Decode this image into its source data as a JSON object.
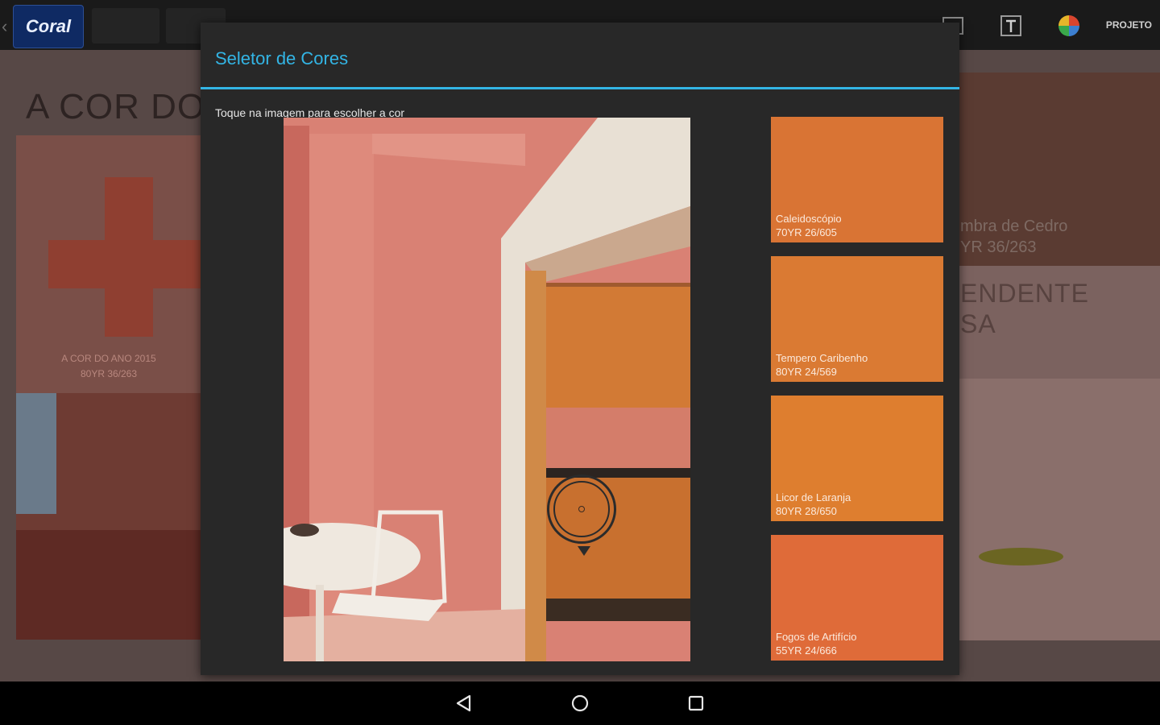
{
  "app": {
    "logo_text": "Coral",
    "back_icon": "chevron-left-icon",
    "project_label": "PROJETO",
    "toolbar_icons": [
      "image-icon",
      "text-icon",
      "color-wheel-icon"
    ]
  },
  "background": {
    "heading": "A COR DO",
    "left_caption_line1": "A COR DO ANO 2015",
    "left_caption_line2": "80YR 36/263",
    "right_text_line1": "mbra de Cedro",
    "right_text_line2": "YR 36/263",
    "right_heading_line1": "ENDENTE",
    "right_heading_line2": "SA"
  },
  "dialog": {
    "title": "Seletor de Cores",
    "hint": "Toque na imagem para escolher a cor",
    "accent_color": "#33b5e5",
    "swatches": [
      {
        "name": "Caleidoscópio",
        "code": "70YR 26/605",
        "color": "#d97434"
      },
      {
        "name": "Tempero Caribenho",
        "code": "80YR 24/569",
        "color": "#da7a33"
      },
      {
        "name": "Licor de Laranja",
        "code": "80YR 28/650",
        "color": "#de7e2f"
      },
      {
        "name": "Fogos de Artifício",
        "code": "55YR 24/666",
        "color": "#df6b39"
      }
    ]
  },
  "navbar": {
    "buttons": [
      "back-icon",
      "home-icon",
      "recents-icon"
    ]
  }
}
